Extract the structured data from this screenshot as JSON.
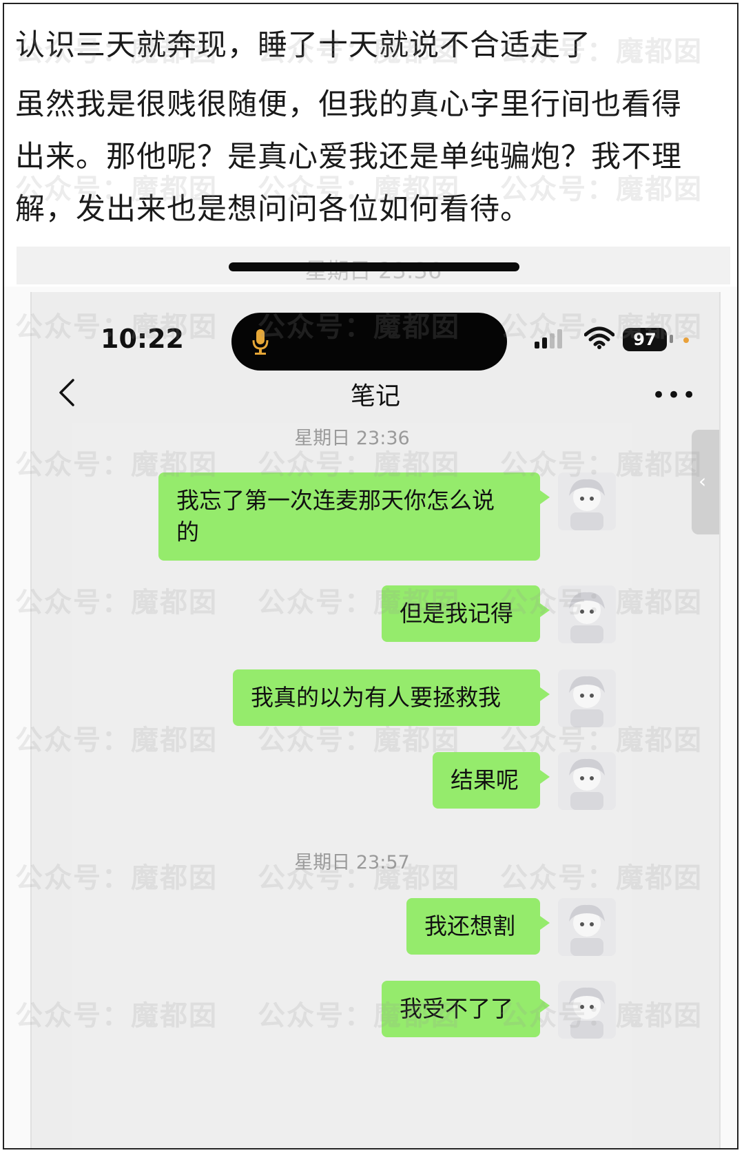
{
  "caption": {
    "line1": "认识三天就奔现，睡了十天就说不合适走了",
    "line2": "虽然我是很贱很随便，但我的真心字里行间也看得",
    "line3": "出来。那他呢？是真心爱我还是单纯骗炮？我不理",
    "line4": "解，发出来也是想问问各位如何看待。",
    "ghost_timestamp": "星期日 23:36"
  },
  "status_bar": {
    "time": "10:22",
    "battery": "97",
    "icons": [
      "mic-icon",
      "signal-icon",
      "wifi-icon",
      "battery-icon"
    ]
  },
  "navbar": {
    "title": "笔记",
    "back_icon": "chevron-left-icon",
    "more_icon": "more-icon",
    "more_label": "•••"
  },
  "chat": {
    "timestamp1": "星期日 23:36",
    "timestamp2": "星期日 23:57",
    "messages": [
      {
        "line1": "我忘了第一次连麦那天你怎么说",
        "line2": "的"
      },
      {
        "text": "但是我记得"
      },
      {
        "text": "我真的以为有人要拯救我"
      },
      {
        "text": "结果呢"
      },
      {
        "text": "我还想割"
      },
      {
        "text": "我受不了了"
      }
    ],
    "side_tab_icon": "‹"
  },
  "watermark": {
    "text": "公众号：魔都囡"
  },
  "colors": {
    "bubble": "#95eb6c",
    "chat_bg": "#eeeeee",
    "timestamp": "#9a9a9a",
    "battery": "#111111"
  }
}
